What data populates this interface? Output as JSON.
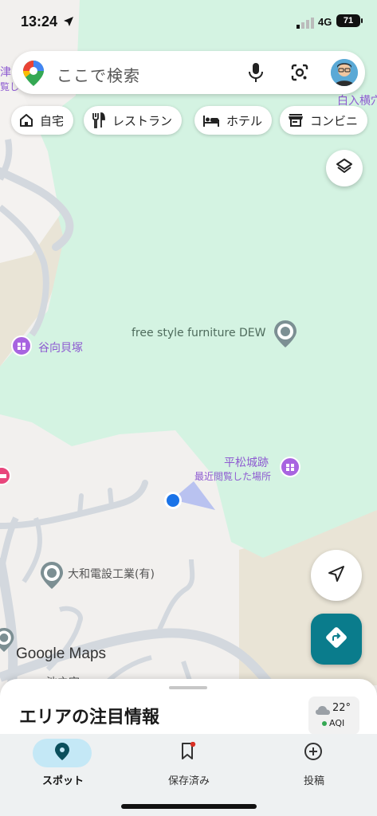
{
  "status_bar": {
    "time": "13:24",
    "network": "4G",
    "battery": "71"
  },
  "search": {
    "placeholder": "ここで検索",
    "logo_icon": "google-maps-pin-icon",
    "mic_icon": "microphone-icon",
    "lens_icon": "google-lens-icon",
    "avatar": "user-avatar"
  },
  "chips": [
    {
      "label": "自宅",
      "icon": "home-icon"
    },
    {
      "label": "レストラン",
      "icon": "restaurant-icon"
    },
    {
      "label": "ホテル",
      "icon": "hotel-icon"
    },
    {
      "label": "コンビニ",
      "icon": "store-icon"
    }
  ],
  "map_labels": {
    "furniture": "free style furniture DEW",
    "shell_mound": "谷向貝塚",
    "castle": "平松城跡",
    "castle_sub": "最近閲覧した場所",
    "company": "大和電設工業(有)",
    "edge_top_left": "津",
    "edge_top_left_sub": "覧し",
    "edge_top_right": "白入横穴",
    "edge_bottom": "池之空"
  },
  "attribution": "Google Maps",
  "sheet": {
    "title": "エリアの注目情報",
    "weather_temp": "22°",
    "weather_aqi": "AQI"
  },
  "nav": [
    {
      "label": "スポット",
      "icon": "explore-pin-icon",
      "active": true
    },
    {
      "label": "保存済み",
      "icon": "bookmark-icon",
      "active": false
    },
    {
      "label": "投稿",
      "icon": "add-circle-icon",
      "active": false
    }
  ],
  "colors": {
    "park_green": "#d4f3e2",
    "land": "#f2f0ee",
    "beige": "#e9e4d6",
    "road": "#d3d8de",
    "poi_purple": "#a864e0",
    "location_blue": "#1a73e8",
    "directions_teal": "#0a7c8c",
    "nav_active_bg": "#c4e8f6"
  }
}
